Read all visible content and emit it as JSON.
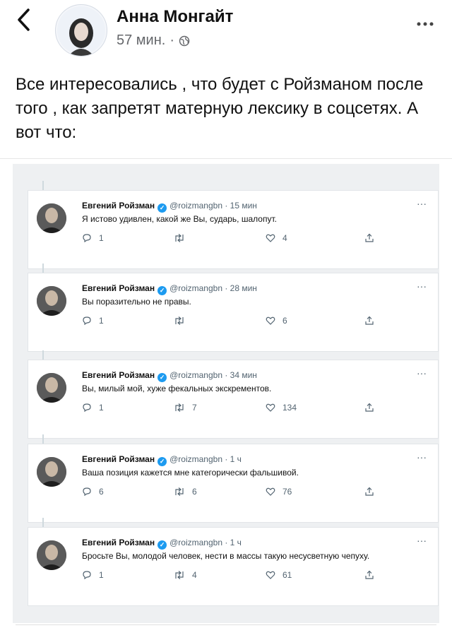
{
  "header": {
    "back_icon": "chevron-left-icon",
    "author": "Анна Монгайт",
    "time": "57 мин.",
    "dot": "·",
    "privacy_icon": "globe-icon",
    "more_icon": "more-horizontal-icon"
  },
  "post": {
    "text": "Все интересовались , что будет с Ройзманом после того , как запретят матерную лексику в соцсетях. А вот что:"
  },
  "tweets": [
    {
      "name": "Евгений Ройзман",
      "handle": "@roizmangbn · 15 мин",
      "text": "Я истово удивлен, какой же Вы, сударь, шалопут.",
      "replies": "1",
      "retweets": "",
      "likes": "4"
    },
    {
      "name": "Евгений Ройзман",
      "handle": "@roizmangbn · 28 мин",
      "text": "Вы поразительно не правы.",
      "replies": "1",
      "retweets": "",
      "likes": "6"
    },
    {
      "name": "Евгений Ройзман",
      "handle": "@roizmangbn · 34 мин",
      "text": "Вы, милый мой, хуже фекальных экскрементов.",
      "replies": "1",
      "retweets": "7",
      "likes": "134"
    },
    {
      "name": "Евгений Ройзман",
      "handle": "@roizmangbn · 1 ч",
      "text": "Ваша позиция кажется мне категорически фальшивой.",
      "replies": "6",
      "retweets": "6",
      "likes": "76"
    },
    {
      "name": "Евгений Ройзман",
      "handle": "@roizmangbn · 1 ч",
      "text": "Бросьте Вы, молодой человек, нести в массы такую несусветную чепуху.",
      "replies": "1",
      "retweets": "4",
      "likes": "61"
    }
  ],
  "colors": {
    "verified": "#1d9bf0",
    "muted": "#536471",
    "text": "#111111"
  }
}
